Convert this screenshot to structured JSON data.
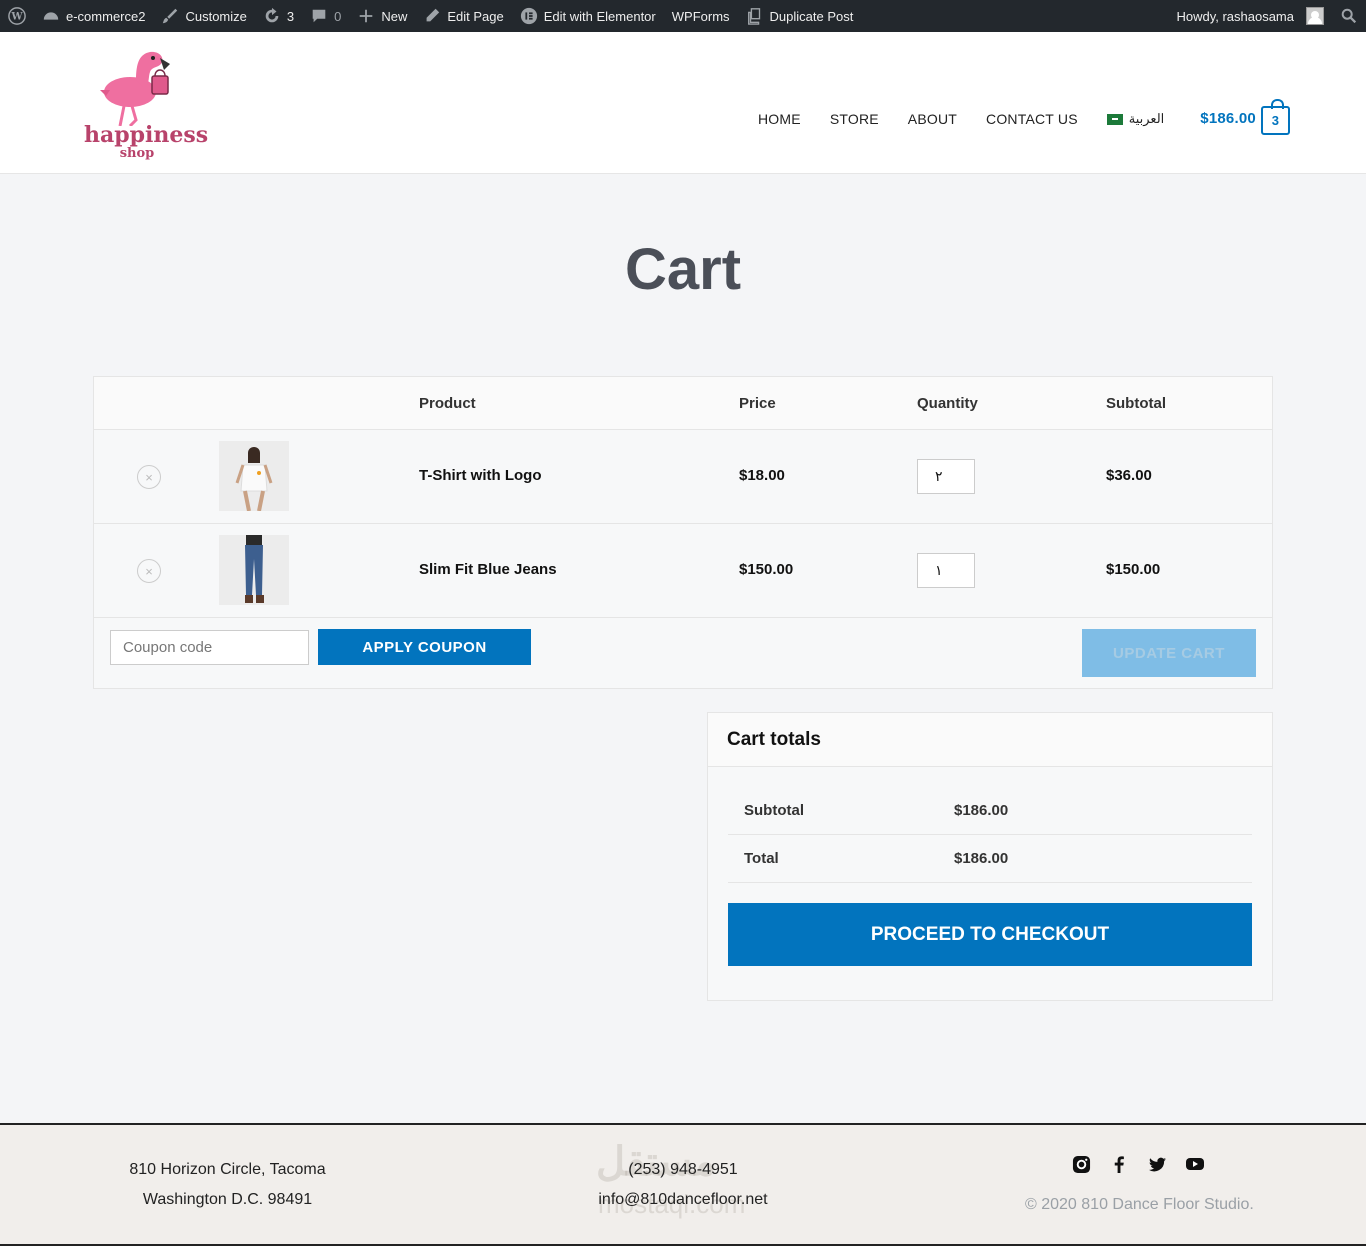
{
  "adminbar": {
    "site": "e-commerce2",
    "customize": "Customize",
    "updates": "3",
    "comments": "0",
    "new": "New",
    "edit_page": "Edit Page",
    "elementor": "Edit with Elementor",
    "wpforms": "WPForms",
    "duplicate": "Duplicate Post",
    "howdy": "Howdy, rashaosama"
  },
  "header": {
    "logo_text": "happiness",
    "logo_sub": "shop",
    "nav": [
      "HOME",
      "STORE",
      "ABOUT",
      "CONTACT US"
    ],
    "language": "العربية",
    "cart_total": "$186.00",
    "cart_count": "3"
  },
  "page": {
    "title": "Cart"
  },
  "cart": {
    "headers": {
      "product": "Product",
      "price": "Price",
      "quantity": "Quantity",
      "subtotal": "Subtotal"
    },
    "items": [
      {
        "name": "T-Shirt with Logo",
        "price": "$18.00",
        "qty": "٢",
        "subtotal": "$36.00",
        "remove": "×"
      },
      {
        "name": "Slim Fit Blue Jeans",
        "price": "$150.00",
        "qty": "١",
        "subtotal": "$150.00",
        "remove": "×"
      }
    ],
    "coupon_placeholder": "Coupon code",
    "apply_label": "APPLY COUPON",
    "update_label": "UPDATE CART"
  },
  "totals": {
    "title": "Cart totals",
    "subtotal_label": "Subtotal",
    "subtotal_value": "$186.00",
    "total_label": "Total",
    "total_value": "$186.00",
    "checkout_label": "PROCEED TO CHECKOUT"
  },
  "footer": {
    "address1": "810 Horizon Circle, Tacoma",
    "address2": "Washington D.C. 98491",
    "phone": "(253) 948-4951",
    "email": "info@810dancefloor.net",
    "copyright": "© 2020 810 Dance Floor Studio.",
    "watermark": "مستقل",
    "watermark2": "mostaql.com",
    "social_icons": [
      "instagram-icon",
      "facebook-icon",
      "twitter-icon",
      "youtube-icon"
    ]
  },
  "colors": {
    "accent": "#0274be",
    "brand": "#b8436b",
    "adminbar": "#23282d"
  }
}
